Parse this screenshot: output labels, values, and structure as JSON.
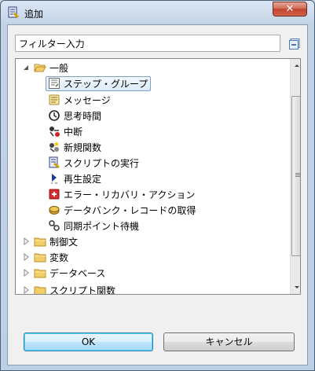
{
  "window": {
    "title": "追加",
    "close_glyph": "✕"
  },
  "filter": {
    "value": "フィルター入力",
    "placeholder": ""
  },
  "tree": {
    "items": [
      {
        "label": "一般",
        "expanded": true,
        "level": 0,
        "icon": "folder-open-icon"
      },
      {
        "label": "ステップ・グループ",
        "level": 1,
        "icon": "step-group-icon",
        "selected": true
      },
      {
        "label": "メッセージ",
        "level": 1,
        "icon": "message-icon"
      },
      {
        "label": "思考時間",
        "level": 1,
        "icon": "clock-icon"
      },
      {
        "label": "中断",
        "level": 1,
        "icon": "abort-icon"
      },
      {
        "label": "新規関数",
        "level": 1,
        "icon": "new-function-icon"
      },
      {
        "label": "スクリプトの実行",
        "level": 1,
        "icon": "run-script-icon"
      },
      {
        "label": "再生設定",
        "level": 1,
        "icon": "playback-settings-icon"
      },
      {
        "label": "エラー・リカバリ・アクション",
        "level": 1,
        "icon": "error-recovery-icon"
      },
      {
        "label": "データバンク・レコードの取得",
        "level": 1,
        "icon": "databank-icon"
      },
      {
        "label": "同期ポイント待機",
        "level": 1,
        "icon": "sync-point-icon"
      },
      {
        "label": "制御文",
        "expanded": false,
        "level": 0,
        "icon": "folder-icon"
      },
      {
        "label": "変数",
        "expanded": false,
        "level": 0,
        "icon": "folder-icon"
      },
      {
        "label": "データベース",
        "expanded": false,
        "level": 0,
        "icon": "folder-icon"
      },
      {
        "label": "スクリプト関数",
        "expanded": false,
        "level": 0,
        "icon": "folder-icon"
      }
    ]
  },
  "buttons": {
    "ok": "OK",
    "cancel": "キャンセル"
  },
  "colors": {
    "selection_border": "#7da2ce",
    "folder": "#e8c25a",
    "close": "#c1432c"
  }
}
